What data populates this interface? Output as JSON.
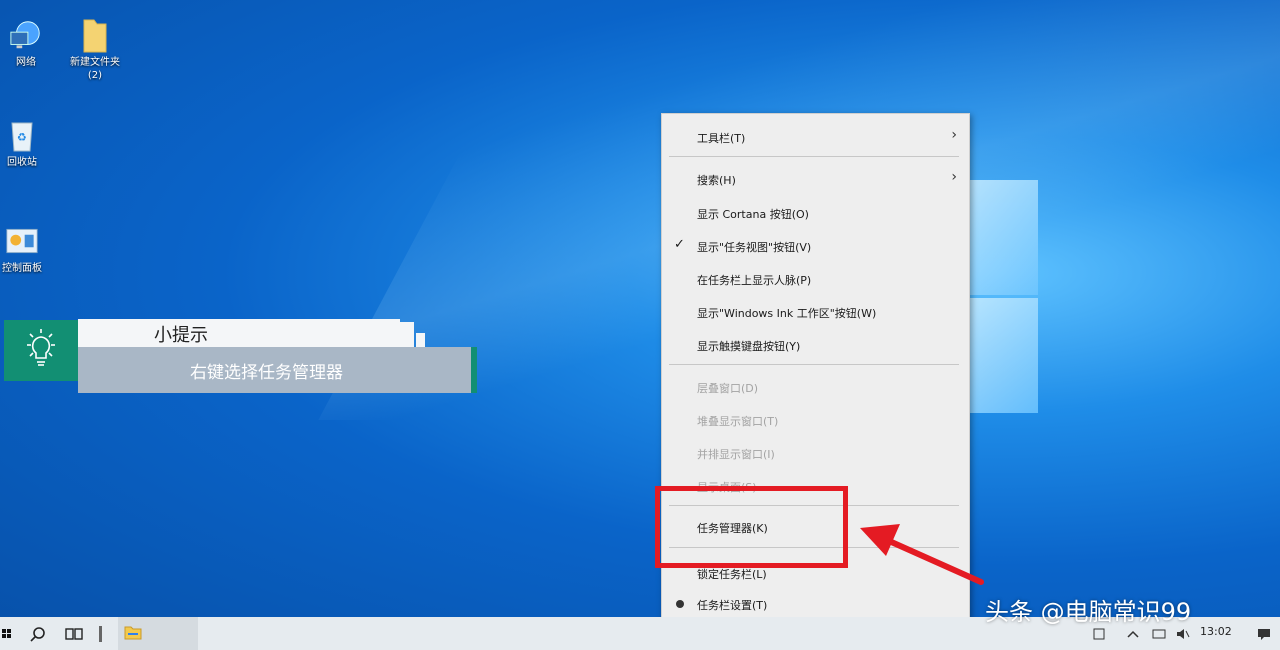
{
  "desktop": {
    "icons": [
      {
        "label": "网络"
      },
      {
        "label": "新建文件夹\n(2)"
      },
      {
        "label": "回收站"
      },
      {
        "label": "控制面板"
      }
    ]
  },
  "tip": {
    "title": "小提示",
    "text": "右键选择任务管理器"
  },
  "context_menu": {
    "items": [
      {
        "label": "工具栏(T)"
      },
      {
        "label": "搜索(H)"
      },
      {
        "label": "显示 Cortana 按钮(O)"
      },
      {
        "label": "显示\"任务视图\"按钮(V)"
      },
      {
        "label": "在任务栏上显示人脉(P)"
      },
      {
        "label": "显示\"Windows Ink 工作区\"按钮(W)"
      },
      {
        "label": "显示触摸键盘按钮(Y)"
      },
      {
        "label": "层叠窗口(D)"
      },
      {
        "label": "堆叠显示窗口(T)"
      },
      {
        "label": "并排显示窗口(I)"
      },
      {
        "label": "显示桌面(S)"
      },
      {
        "label": "任务管理器(K)"
      },
      {
        "label": "锁定任务栏(L)"
      },
      {
        "label": "任务栏设置(T)"
      }
    ]
  },
  "taskbar": {
    "time": "13:02"
  },
  "watermark": "头条 @电脑常识99",
  "colors": {
    "highlight": "#e41b23",
    "tip_accent": "#128f73"
  }
}
